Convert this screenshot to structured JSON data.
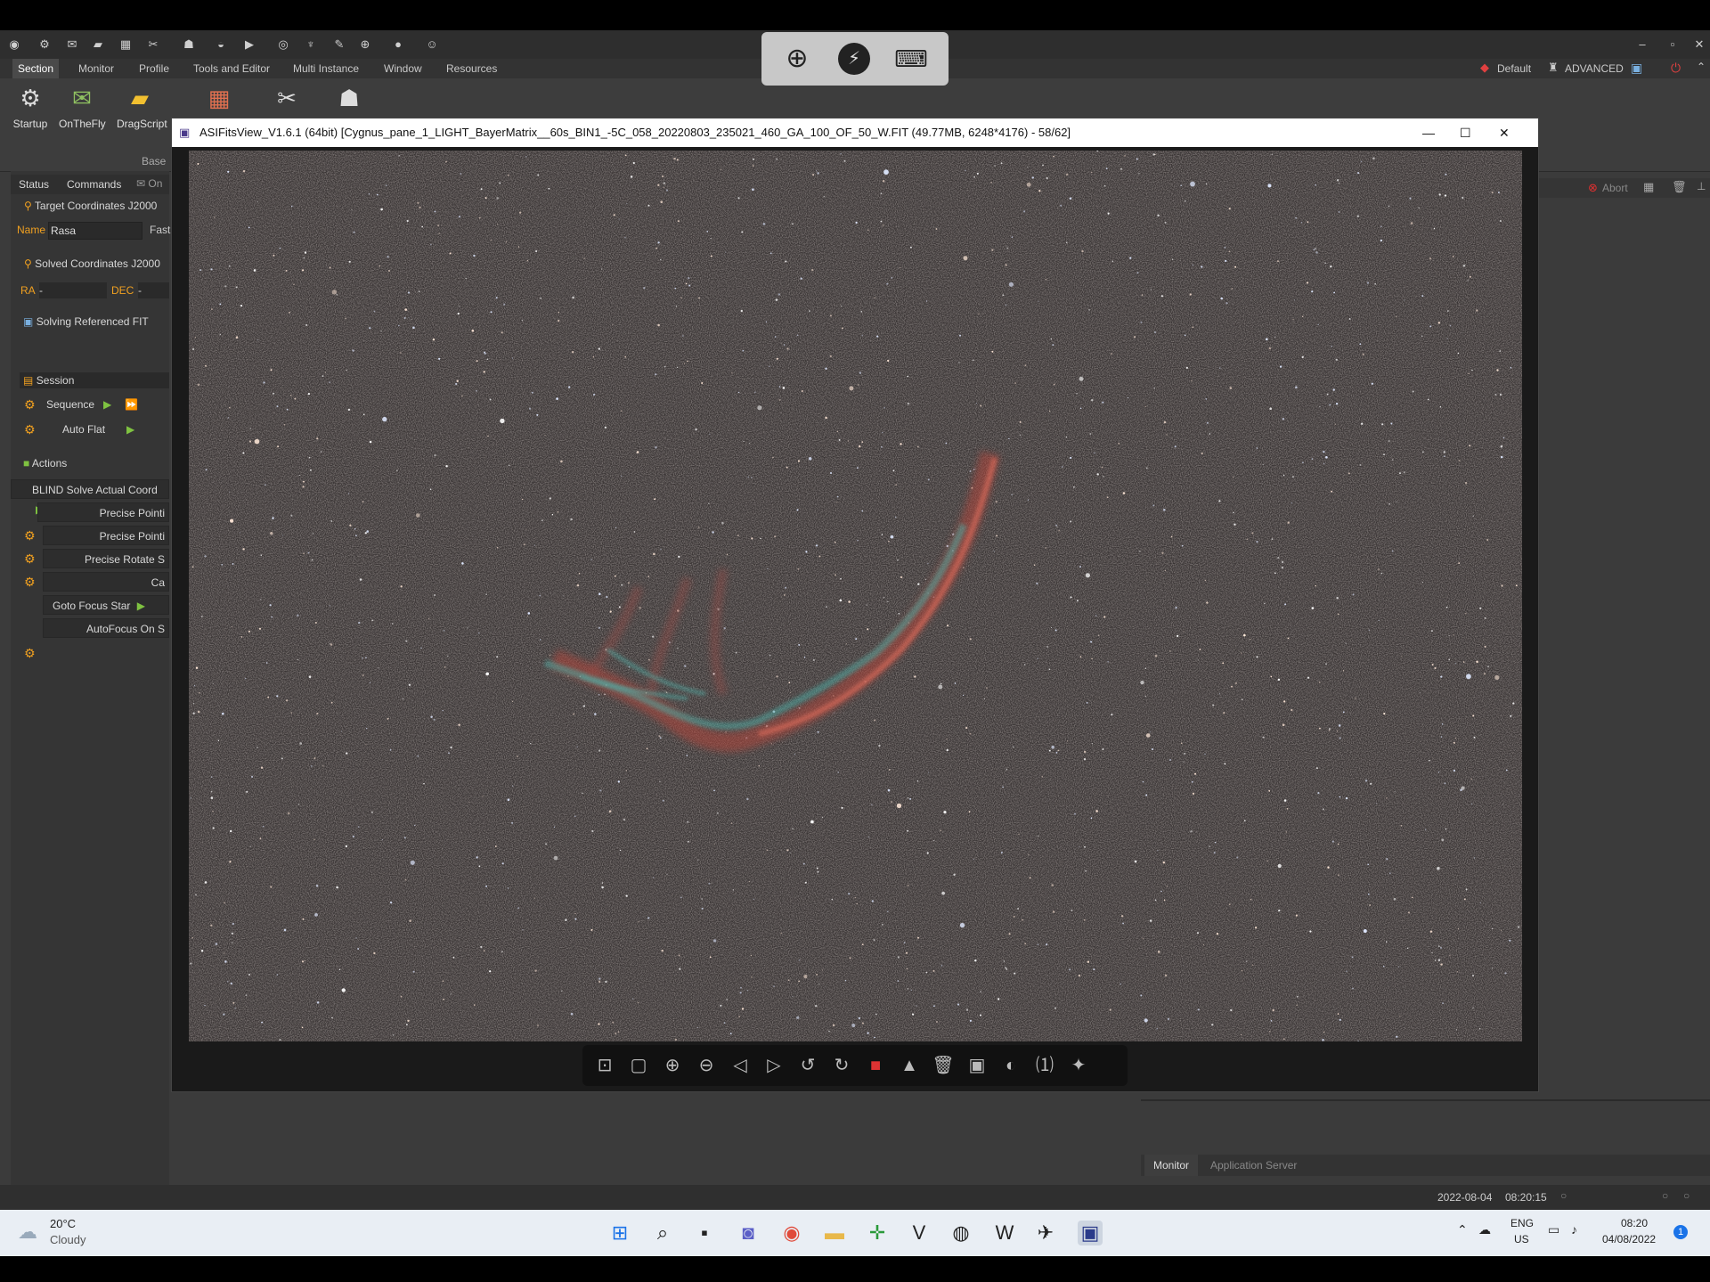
{
  "app": {
    "menu": [
      "Section",
      "Monitor",
      "Profile",
      "Tools and Editor",
      "Multi Instance",
      "Window",
      "Resources"
    ],
    "profile_label": "Default",
    "mode_label": "ADVANCED",
    "ribbon": {
      "buttons": [
        "Startup",
        "OnTheFly",
        "DragScript"
      ],
      "group_label": "Base"
    }
  },
  "left_panel": {
    "tabs": [
      "Status",
      "Commands",
      "On"
    ],
    "target_header": "Target Coordinates J2000",
    "name_label": "Name",
    "name_value": "Rasa",
    "fast_label": "Fast",
    "solved_header": "Solved Coordinates J2000",
    "ra_label": "RA",
    "ra_value": "-",
    "dec_label": "DEC",
    "dec_value": "-",
    "solving_header": "Solving Referenced FIT",
    "session_header": "Session",
    "sequence_label": "Sequence",
    "autoflat_label": "Auto Flat",
    "actions_header": "Actions",
    "actions": [
      "BLIND Solve Actual Coord",
      "Precise Pointi",
      "Precise Pointi",
      "Precise Rotate S",
      "Ca",
      "Goto Focus Star",
      "AutoFocus On S"
    ]
  },
  "right_panel": {
    "abort_label": "Abort",
    "tabs": [
      "Monitor",
      "Application Server"
    ]
  },
  "status_bar": {
    "date": "2022-08-04",
    "time": "08:20:15"
  },
  "fits_view": {
    "title": "ASIFitsView_V1.6.1 (64bit) [Cygnus_pane_1_LIGHT_BayerMatrix__60s_BIN1_-5C_058_20220803_235021_460_GA_100_OF_50_W.FIT (49.77MB, 6248*4176) - 58/62]",
    "image_alt": "Veil Nebula star field",
    "toolbar_icons": [
      "fit-1to1-icon",
      "fit-window-icon",
      "zoom-in-icon",
      "zoom-out-icon",
      "previous-icon",
      "next-icon",
      "rotate-left-icon",
      "rotate-right-icon",
      "color-channels-icon",
      "histogram-icon",
      "delete-icon",
      "save-icon",
      "stretch-icon",
      "single-view-icon",
      "star-icon"
    ]
  },
  "taskbar": {
    "weather_temp": "20°C",
    "weather_desc": "Cloudy",
    "lang_top": "ENG",
    "lang_bottom": "US",
    "clock_time": "08:20",
    "clock_date": "04/08/2022",
    "notification_count": "1"
  },
  "colors": {
    "accent_orange": "#f0a020",
    "play_green": "#7fc241",
    "abort_red": "#e03030"
  }
}
